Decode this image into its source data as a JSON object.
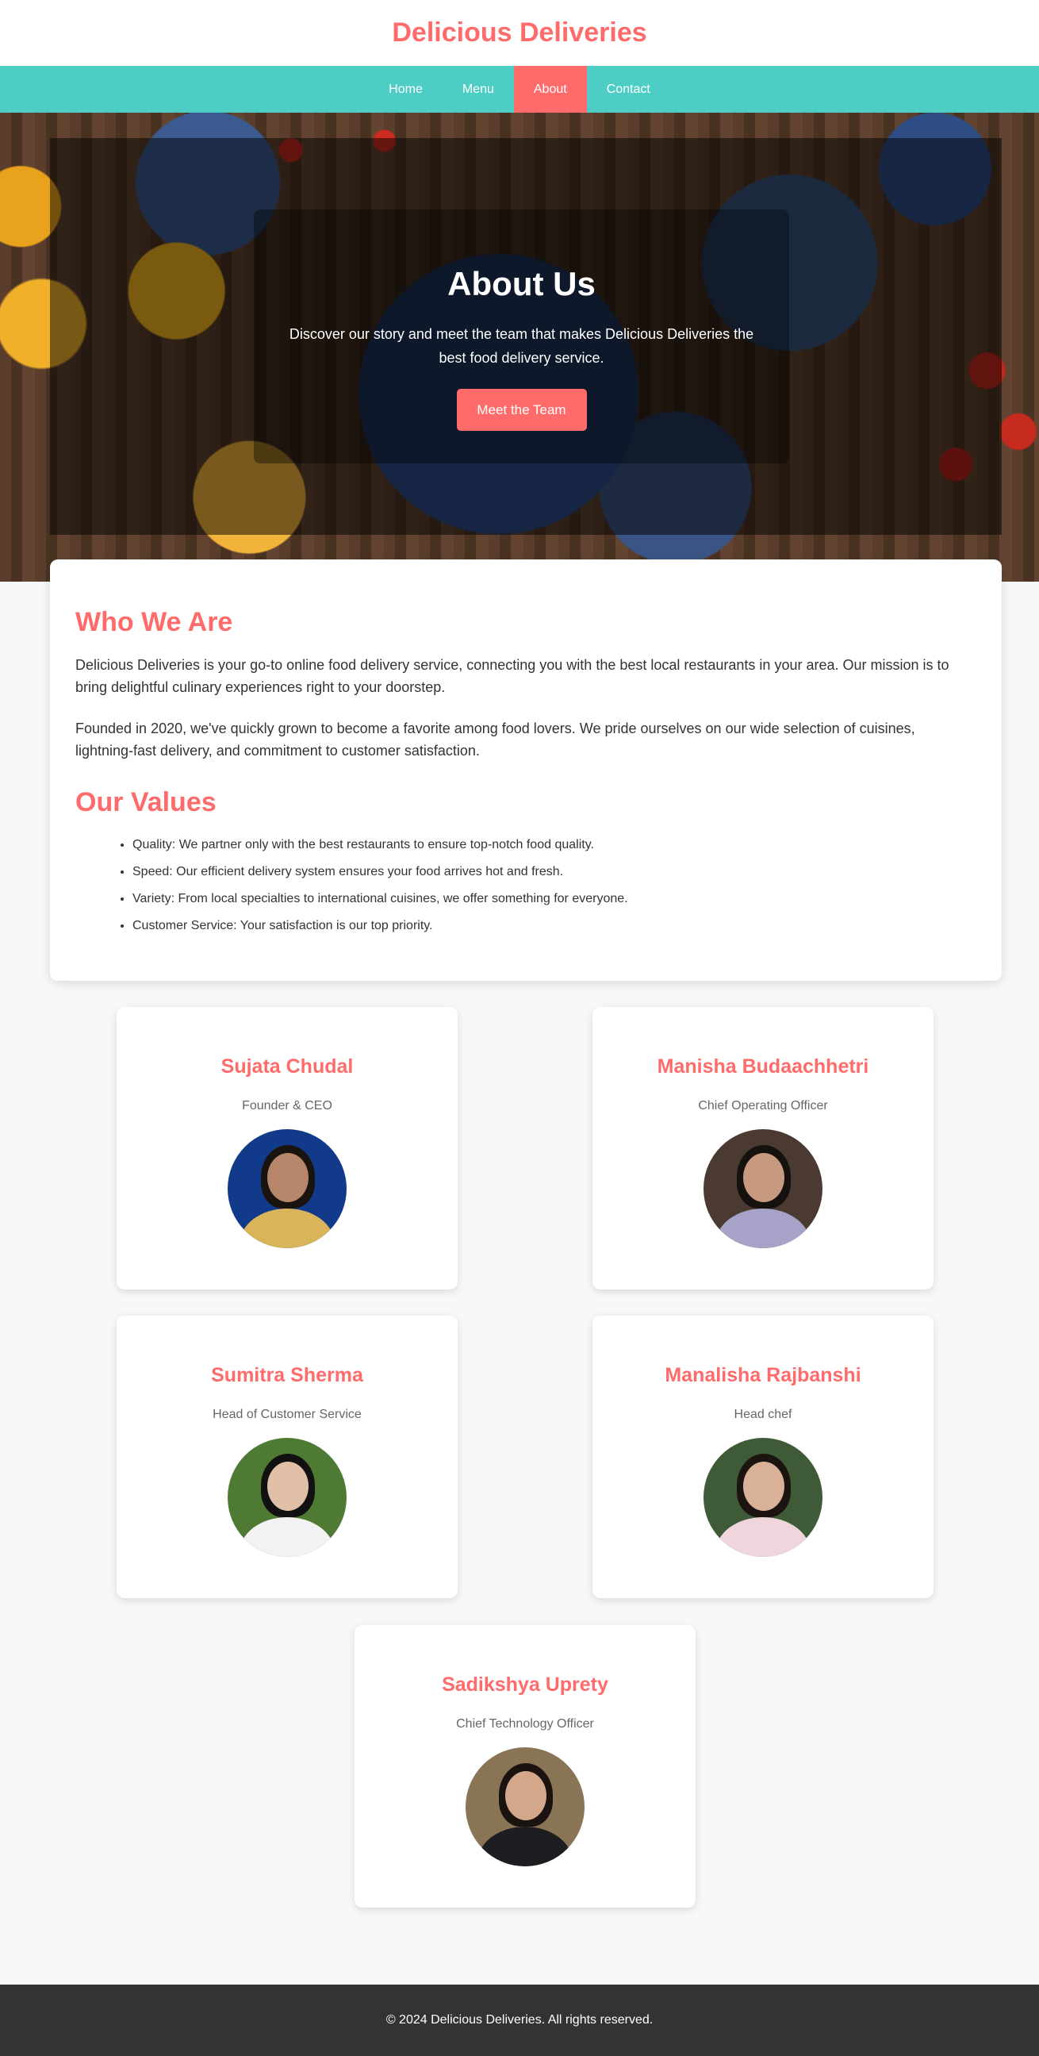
{
  "header": {
    "title": "Delicious Deliveries"
  },
  "nav": {
    "items": [
      {
        "label": "Home",
        "active": false
      },
      {
        "label": "Menu",
        "active": false
      },
      {
        "label": "About",
        "active": true
      },
      {
        "label": "Contact",
        "active": false
      }
    ]
  },
  "hero": {
    "title": "About Us",
    "text": "Discover our story and meet the team that makes Delicious Deliveries the best food delivery service.",
    "button_label": "Meet the Team"
  },
  "about": {
    "heading": "Who We Are",
    "paragraphs": [
      "Delicious Deliveries is your go-to online food delivery service, connecting you with the best local restaurants in your area. Our mission is to bring delightful culinary experiences right to your doorstep.",
      "Founded in 2020, we've quickly grown to become a favorite among food lovers. We pride ourselves on our wide selection of cuisines, lightning-fast delivery, and commitment to customer satisfaction."
    ],
    "values_heading": "Our Values",
    "values": [
      "Quality: We partner only with the best restaurants to ensure top-notch food quality.",
      "Speed: Our efficient delivery system ensures your food arrives hot and fresh.",
      "Variety: From local specialties to international cuisines, we offer something for everyone.",
      "Customer Service: Your satisfaction is our top priority."
    ]
  },
  "team": [
    {
      "name": "Sujata Chudal",
      "role": "Founder & CEO"
    },
    {
      "name": "Manisha Budaachhetri",
      "role": "Chief Operating Officer"
    },
    {
      "name": "Sumitra Sherma",
      "role": "Head of Customer Service"
    },
    {
      "name": "Manalisha Rajbanshi",
      "role": "Head chef"
    },
    {
      "name": "Sadikshya Uprety",
      "role": "Chief Technology Officer"
    }
  ],
  "footer": {
    "text": "© 2024 Delicious Deliveries. All rights reserved."
  },
  "colors": {
    "accent": "#ff6b6b",
    "nav": "#4ecdc4",
    "footer": "#333333"
  }
}
